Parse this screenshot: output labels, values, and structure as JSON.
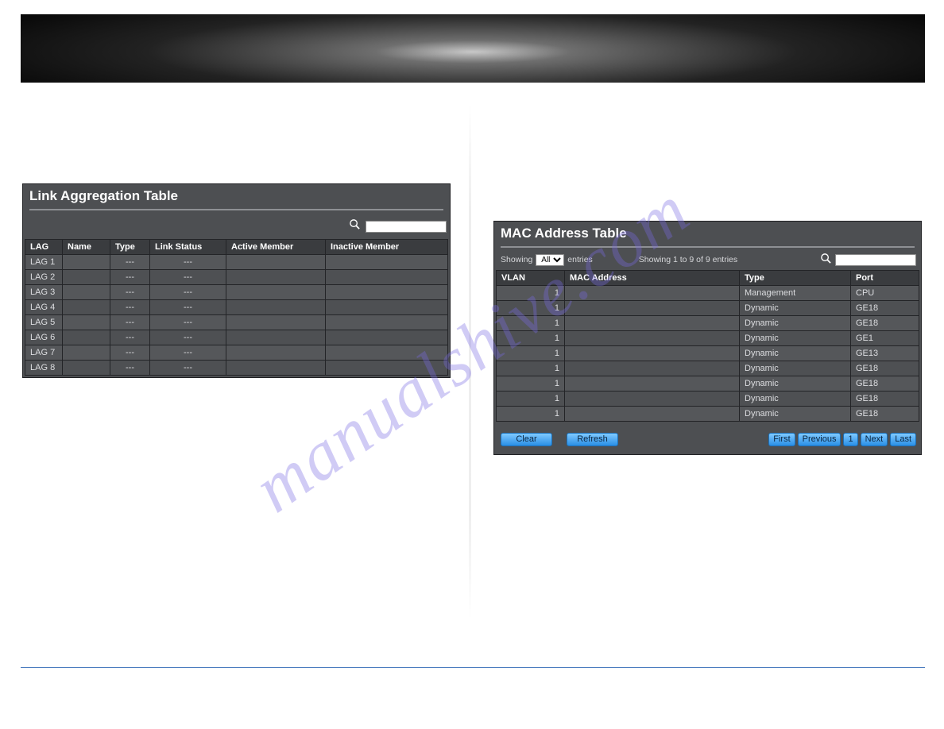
{
  "watermark": "manualshive.com",
  "link_agg": {
    "title": "Link Aggregation Table",
    "search_placeholder": "",
    "columns": [
      "LAG",
      "Name",
      "Type",
      "Link Status",
      "Active Member",
      "Inactive Member"
    ],
    "rows": [
      {
        "lag": "LAG 1",
        "name": "",
        "type": "---",
        "status": "---",
        "active": "",
        "inactive": ""
      },
      {
        "lag": "LAG 2",
        "name": "",
        "type": "---",
        "status": "---",
        "active": "",
        "inactive": ""
      },
      {
        "lag": "LAG 3",
        "name": "",
        "type": "---",
        "status": "---",
        "active": "",
        "inactive": ""
      },
      {
        "lag": "LAG 4",
        "name": "",
        "type": "---",
        "status": "---",
        "active": "",
        "inactive": ""
      },
      {
        "lag": "LAG 5",
        "name": "",
        "type": "---",
        "status": "---",
        "active": "",
        "inactive": ""
      },
      {
        "lag": "LAG 6",
        "name": "",
        "type": "---",
        "status": "---",
        "active": "",
        "inactive": ""
      },
      {
        "lag": "LAG 7",
        "name": "",
        "type": "---",
        "status": "---",
        "active": "",
        "inactive": ""
      },
      {
        "lag": "LAG 8",
        "name": "",
        "type": "---",
        "status": "---",
        "active": "",
        "inactive": ""
      }
    ]
  },
  "mac_table": {
    "title": "MAC Address Table",
    "showing_prefix": "Showing",
    "entries_suffix": "entries",
    "entries_selected": "All",
    "showing_summary": "Showing 1 to 9 of 9 entries",
    "search_placeholder": "",
    "columns": [
      "VLAN",
      "MAC Address",
      "Type",
      "Port"
    ],
    "rows": [
      {
        "vlan": "1",
        "mac": "",
        "type": "Management",
        "port": "CPU"
      },
      {
        "vlan": "1",
        "mac": "",
        "type": "Dynamic",
        "port": "GE18"
      },
      {
        "vlan": "1",
        "mac": "",
        "type": "Dynamic",
        "port": "GE18"
      },
      {
        "vlan": "1",
        "mac": "",
        "type": "Dynamic",
        "port": "GE1"
      },
      {
        "vlan": "1",
        "mac": "",
        "type": "Dynamic",
        "port": "GE13"
      },
      {
        "vlan": "1",
        "mac": "",
        "type": "Dynamic",
        "port": "GE18"
      },
      {
        "vlan": "1",
        "mac": "",
        "type": "Dynamic",
        "port": "GE18"
      },
      {
        "vlan": "1",
        "mac": "",
        "type": "Dynamic",
        "port": "GE18"
      },
      {
        "vlan": "1",
        "mac": "",
        "type": "Dynamic",
        "port": "GE18"
      }
    ],
    "buttons": {
      "clear": "Clear",
      "refresh": "Refresh"
    },
    "pager": {
      "first": "First",
      "previous": "Previous",
      "page": "1",
      "next": "Next",
      "last": "Last"
    }
  }
}
